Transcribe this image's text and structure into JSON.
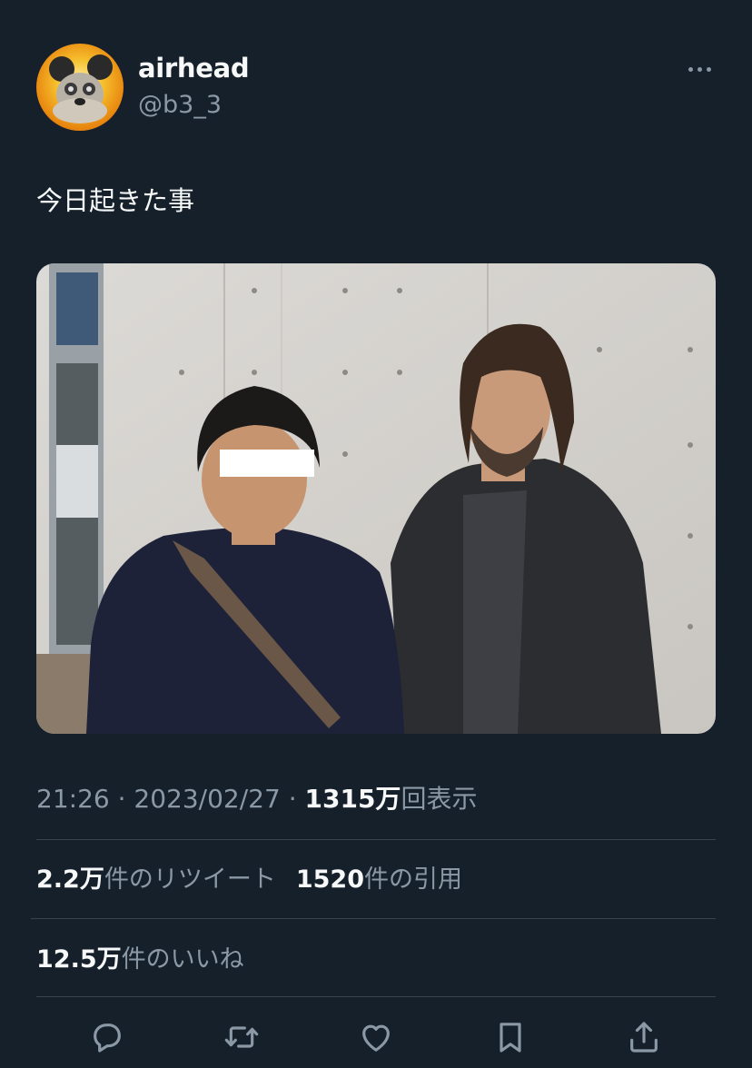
{
  "user": {
    "display_name": "airhead",
    "handle": "@b3_3",
    "avatar_icon": "mouse-avatar-icon"
  },
  "tweet": {
    "text": "今日起きた事"
  },
  "meta": {
    "time": "21:26",
    "sep1": " · ",
    "date": "2023/02/27",
    "sep2": " · ",
    "views_count": "1315万",
    "views_label": "回表示"
  },
  "stats": {
    "retweets_count": "2.2万",
    "retweets_label": "件のリツイート",
    "quotes_count": "1520",
    "quotes_label": "件の引用",
    "likes_count": "12.5万",
    "likes_label": "件のいいね"
  },
  "actions": [
    {
      "name": "reply",
      "icon": "reply-icon"
    },
    {
      "name": "retweet",
      "icon": "retweet-icon"
    },
    {
      "name": "like",
      "icon": "heart-icon"
    },
    {
      "name": "bookmark",
      "icon": "bookmark-icon"
    },
    {
      "name": "share",
      "icon": "share-icon"
    }
  ],
  "colors": {
    "background": "#15202b",
    "primary_text": "#f7f9f9",
    "secondary_text": "#8b98a5",
    "divider": "#38444d"
  }
}
